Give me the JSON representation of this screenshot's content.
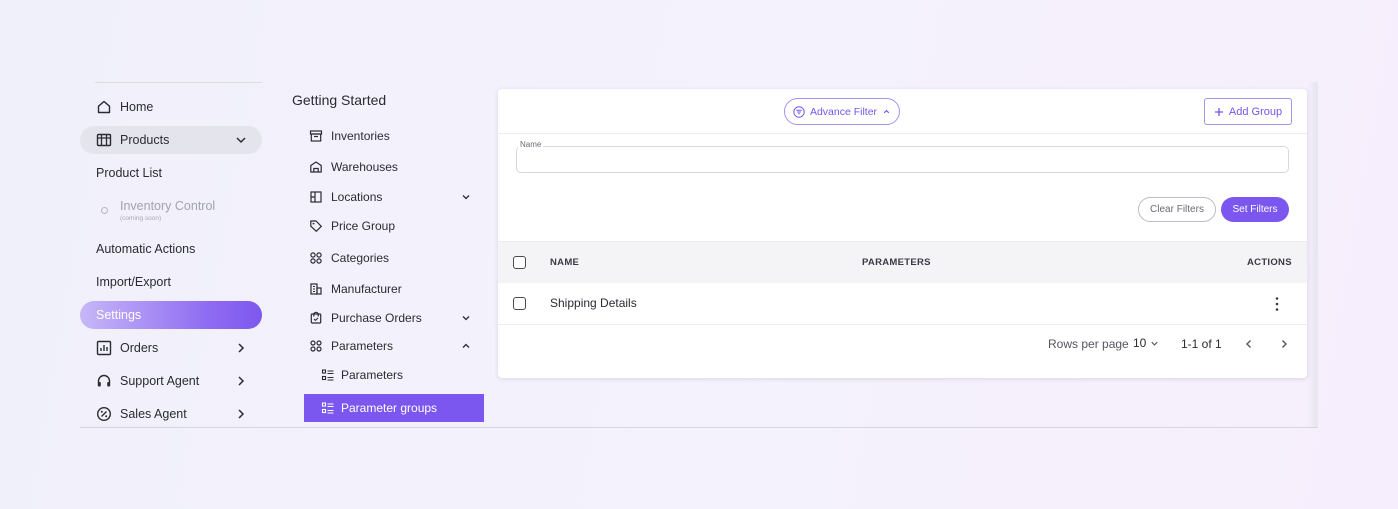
{
  "sidebar": {
    "home": "Home",
    "products": "Products",
    "product_list": "Product List",
    "inventory_control": "Inventory Control",
    "inventory_control_note": "(coming soon)",
    "automatic_actions": "Automatic Actions",
    "import_export": "Import/Export",
    "settings": "Settings",
    "orders": "Orders",
    "support_agent": "Support Agent",
    "sales_agent": "Sales Agent"
  },
  "menu": {
    "title": "Getting Started",
    "inventories": "Inventories",
    "warehouses": "Warehouses",
    "locations": "Locations",
    "price_group": "Price Group",
    "categories": "Categories",
    "manufacturer": "Manufacturer",
    "purchase_orders": "Purchase Orders",
    "parameters": "Parameters",
    "parameters_child": "Parameters",
    "parameter_groups": "Parameter groups"
  },
  "toolbar": {
    "advance_filter": "Advance Filter",
    "add_group": "Add Group"
  },
  "filters": {
    "name_label": "Name",
    "name_value": "",
    "clear": "Clear Filters",
    "set": "Set Filters"
  },
  "table": {
    "headers": {
      "name": "NAME",
      "parameters": "PARAMETERS",
      "actions": "ACTIONS"
    },
    "rows": [
      {
        "name": "Shipping Details",
        "parameters": ""
      }
    ]
  },
  "pagination": {
    "rows_per_page_label": "Rows per page",
    "rows_per_page": "10",
    "range": "1-1 of 1"
  },
  "colors": {
    "accent": "#7b57ef",
    "accent_light": "#a691f3"
  }
}
